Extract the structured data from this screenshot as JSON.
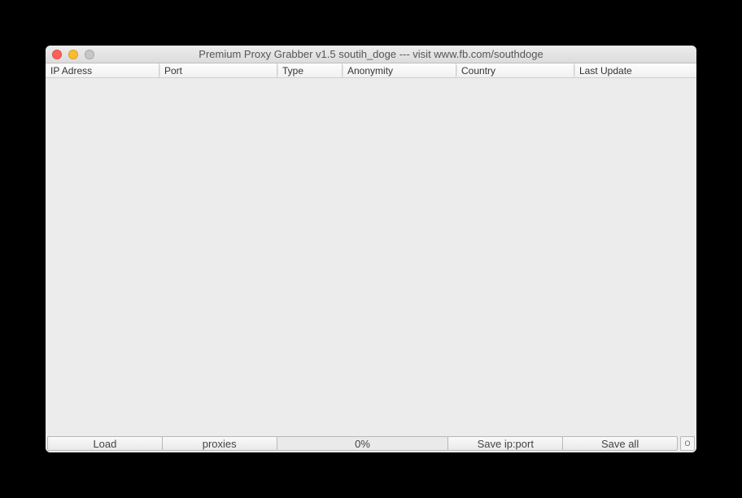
{
  "window": {
    "title": "Premium Proxy Grabber v1.5 soutih_doge --- visit www.fb.com/southdoge"
  },
  "columns": {
    "ip": "IP Adress",
    "port": "Port",
    "type": "Type",
    "anonymity": "Anonymity",
    "country": "Country",
    "last_update": "Last Update"
  },
  "footer": {
    "load": "Load",
    "proxies": "proxies",
    "progress": "0%",
    "save_ip_port": "Save ip:port",
    "save_all": "Save all",
    "status": "O"
  }
}
